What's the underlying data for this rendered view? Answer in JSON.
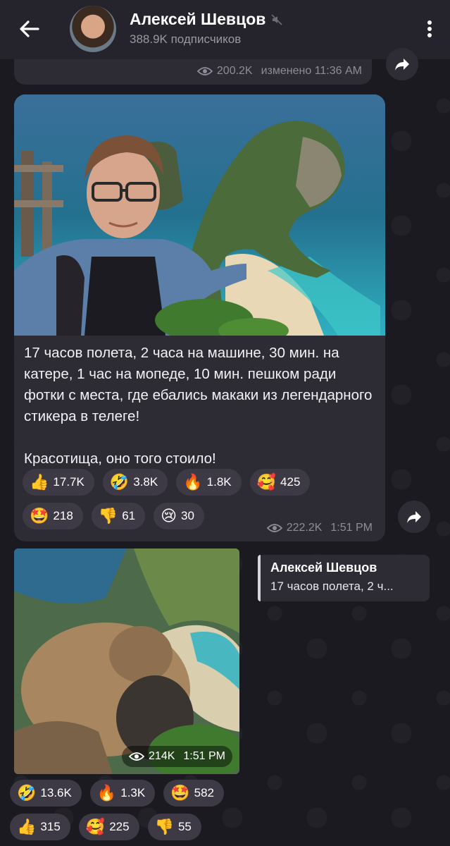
{
  "header": {
    "channel_name": "Алексей Шевцов",
    "subscribers": "388.9K подписчиков",
    "muted_icon": "muted-speaker-icon",
    "back_icon": "arrow-left-icon",
    "menu_icon": "vertical-dots-icon"
  },
  "prev_message": {
    "views": "200.2K",
    "edited_time": "изменено 11:36 AM"
  },
  "post": {
    "text": "17 часов полета, 2 часа на машине, 30 мин. на катере, 1 час на мопеде, 10 мин. пешком ради фотки с места, где ебались макаки из легендарного стикера в телеге!\n\nКрасотища, оно того стоило!",
    "views": "222.2K",
    "time": "1:51 PM",
    "reactions": [
      {
        "emoji": "👍",
        "count": "17.7K"
      },
      {
        "emoji": "🤣",
        "count": "3.8K"
      },
      {
        "emoji": "🔥",
        "count": "1.8K"
      },
      {
        "emoji": "🥰",
        "count": "425"
      },
      {
        "emoji": "🤩",
        "count": "218"
      },
      {
        "emoji": "👎",
        "count": "61"
      },
      {
        "emoji": "😢",
        "count": "30"
      }
    ]
  },
  "reply": {
    "name": "Алексей Шевцов",
    "text": "17 часов полета, 2 ч..."
  },
  "video_post": {
    "views": "214K",
    "time": "1:51 PM",
    "reactions": [
      {
        "emoji": "🤣",
        "count": "13.6K"
      },
      {
        "emoji": "🔥",
        "count": "1.3K"
      },
      {
        "emoji": "🤩",
        "count": "582"
      },
      {
        "emoji": "👍",
        "count": "315"
      },
      {
        "emoji": "🥰",
        "count": "225"
      },
      {
        "emoji": "👎",
        "count": "55"
      }
    ]
  },
  "colors": {
    "background": "#1b1a21",
    "header": "#25232b",
    "bubble": "#2d2b33",
    "reaction_chip": "#3d3a46",
    "meta_text": "#8f8b98"
  }
}
